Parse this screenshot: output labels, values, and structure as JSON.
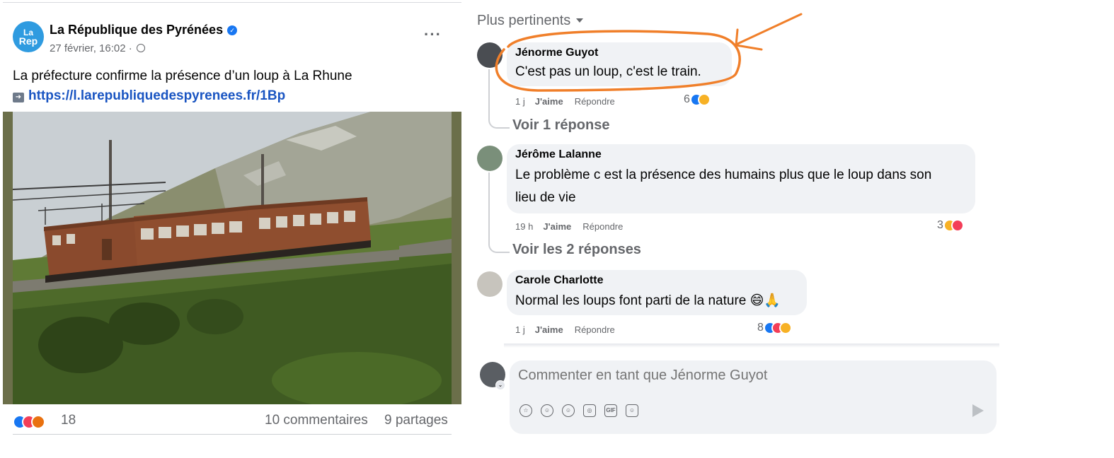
{
  "post": {
    "page_name": "La République des Pyrénées",
    "logo_top": "La",
    "logo_bottom": "Rep",
    "time": "27 février, 16:02 ·",
    "text": "La préfecture confirme la présence d’un loup à La Rhune",
    "link": "https://l.larepubliquedespyrenees.fr/1Bp",
    "reactions_count": "18",
    "comments_count": "10 commentaires",
    "shares_count": "9 partages"
  },
  "comments": {
    "sort_label": "Plus pertinents",
    "items": [
      {
        "author": "Jénorme Guyot",
        "text": "C'est pas un loup, c'est le train.",
        "time": "1 j",
        "like": "J'aime",
        "reply": "Répondre",
        "reactions": "6",
        "see_replies": "Voir 1 réponse"
      },
      {
        "author": "Jérôme Lalanne",
        "text_line1": "Le problème c est la présence des humains plus que le loup dans son",
        "text_line2": "lieu de vie",
        "time": "19 h",
        "like": "J'aime",
        "reply": "Répondre",
        "reactions": "3",
        "see_replies": "Voir les 2 réponses"
      },
      {
        "author": "Carole Charlotte",
        "text": "Normal les loups font parti de la nature 😄🙏",
        "time": "1 j",
        "like": "J'aime",
        "reply": "Répondre",
        "reactions": "8"
      }
    ]
  },
  "composer": {
    "placeholder": "Commenter en tant que Jénorme Guyot",
    "tools": [
      "sticker-icon",
      "avatar-sticker-icon",
      "emoji-icon",
      "camera-icon",
      "gif-icon",
      "sticker-smile-icon"
    ]
  },
  "colors": {
    "accent": "#1877f2",
    "link": "#1a55c2",
    "annotation": "#f07f2a",
    "bubble": "#f0f2f5"
  }
}
